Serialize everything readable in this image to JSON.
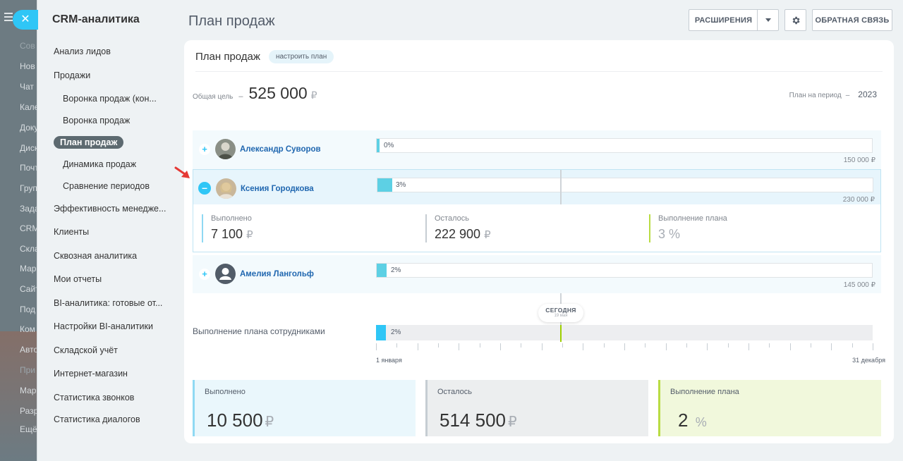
{
  "background": {
    "items": [
      "Сов",
      "Нов",
      "Чат",
      "Кале",
      "Доку",
      "Диск",
      "Почт",
      "Груп",
      "Зада",
      "CRM",
      "Скла",
      "Мар",
      "Сайт",
      "Под",
      "Ком",
      "Авто",
      "При",
      "Мар",
      "Разр",
      "Ещё"
    ]
  },
  "sidebar": {
    "title": "CRM-аналитика",
    "items": [
      {
        "label": "Анализ лидов"
      },
      {
        "label": "Продажи"
      },
      {
        "label": "Воронка продаж (кон..."
      },
      {
        "label": "Воронка продаж"
      },
      {
        "label": "План продаж"
      },
      {
        "label": "Динамика продаж"
      },
      {
        "label": "Сравнение периодов"
      },
      {
        "label": "Эффективность менедже..."
      },
      {
        "label": "Клиенты"
      },
      {
        "label": "Сквозная аналитика"
      },
      {
        "label": "Мои отчеты"
      },
      {
        "label": "BI-аналитика: готовые от..."
      },
      {
        "label": "Настройки BI-аналитики"
      },
      {
        "label": "Складской учёт"
      },
      {
        "label": "Интернет-магазин"
      },
      {
        "label": "Статистика звонков"
      },
      {
        "label": "Статистика диалогов"
      }
    ]
  },
  "header": {
    "title": "План продаж",
    "extensions_label": "РАСШИРЕНИЯ",
    "feedback_label": "ОБРАТНАЯ СВЯЗЬ"
  },
  "panel": {
    "title": "План продаж",
    "configure_label": "настроить план",
    "goal_label": "Общая цель",
    "goal_dash": "–",
    "goal_value": "525 000",
    "currency": "₽",
    "period_label": "План на период",
    "period_dash": "–",
    "period_value": "2023"
  },
  "employees": [
    {
      "name": "Александр Суворов",
      "percent": "0%",
      "progress": 0.0,
      "amount": "150 000 ₽",
      "expanded": false
    },
    {
      "name": "Ксения Городкова",
      "percent": "3%",
      "progress": 0.03,
      "amount": "230 000 ₽",
      "expanded": true,
      "stats": {
        "done_label": "Выполнено",
        "done_value": "7 100",
        "left_label": "Осталось",
        "left_value": "222 900",
        "plan_label": "Выполнение плана",
        "plan_value": "3 %"
      }
    },
    {
      "name": "Амелия Лангольф",
      "percent": "2%",
      "progress": 0.02,
      "amount": "145 000 ₽",
      "expanded": false
    }
  ],
  "today": {
    "label": "СЕГОДНЯ",
    "date": "19 мая"
  },
  "total": {
    "label": "Выполнение плана сотрудниками",
    "percent": "2%",
    "progress": 0.02,
    "start_label": "1 января",
    "end_label": "31 декабря"
  },
  "summary": {
    "done_label": "Выполнено",
    "done_value": "10 500",
    "left_label": "Осталось",
    "left_value": "514 500",
    "plan_label": "Выполнение плана",
    "plan_value": "2",
    "plan_unit": "%"
  },
  "colors": {
    "accent": "#2fc6f6",
    "progress": "#5dd0e4",
    "today": "#9dcf00",
    "link": "#2067b0"
  }
}
